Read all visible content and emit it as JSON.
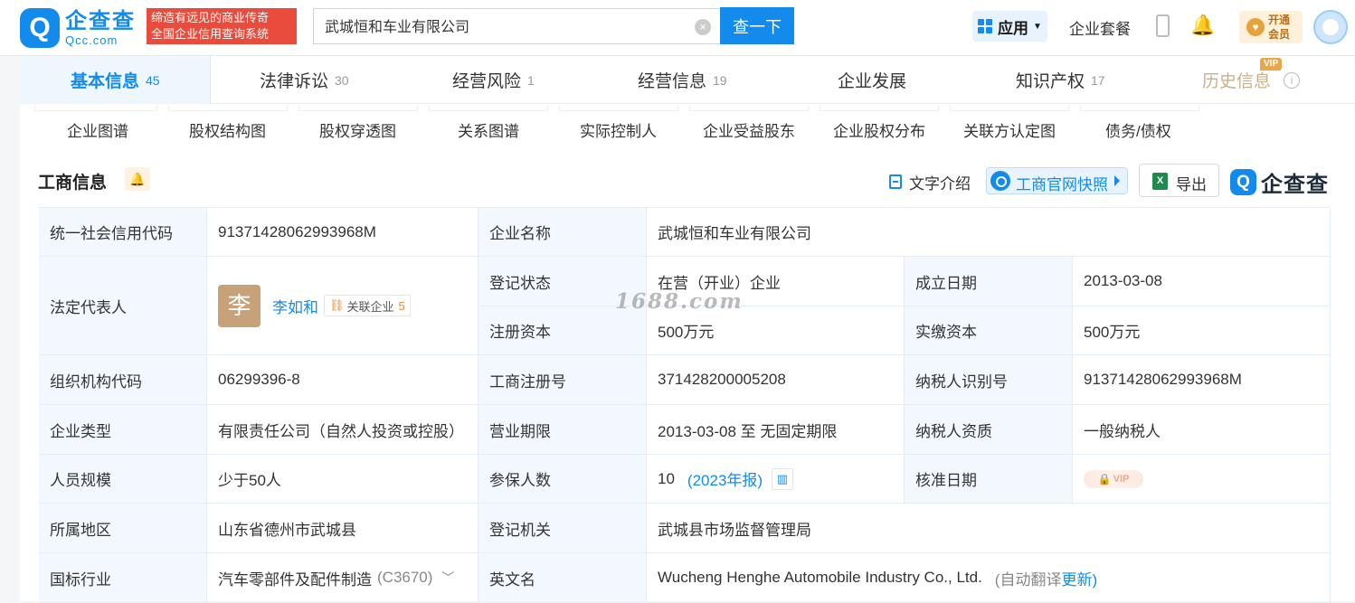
{
  "header": {
    "logo_cn": "企查查",
    "logo_en": "Qcc.com",
    "slogan_line1": "缔造有远见的商业传奇",
    "slogan_line2": "全国企业信用查询系统",
    "search_value": "武城恒和车业有限公司",
    "search_button": "查一下",
    "app_label": "应用",
    "suite_label": "企业套餐",
    "vip_line1": "开通",
    "vip_line2": "会员"
  },
  "tabs": [
    {
      "label": "基本信息",
      "count": "45",
      "active": true
    },
    {
      "label": "法律诉讼",
      "count": "30"
    },
    {
      "label": "经营风险",
      "count": "1"
    },
    {
      "label": "经营信息",
      "count": "19"
    },
    {
      "label": "企业发展",
      "count": ""
    },
    {
      "label": "知识产权",
      "count": "17"
    },
    {
      "label": "历史信息",
      "count": "",
      "vip": "VIP"
    }
  ],
  "subnav": [
    "企业图谱",
    "股权结构图",
    "股权穿透图",
    "关系图谱",
    "实际控制人",
    "企业受益股东",
    "企业股权分布",
    "关联方认定图",
    "债务/债权"
  ],
  "section": {
    "title": "工商信息",
    "text_intro": "文字介绍",
    "snapshot": "工商官网快照",
    "export": "导出",
    "brand": "企查查"
  },
  "info": {
    "credit_code_label": "统一社会信用代码",
    "credit_code": "91371428062993968M",
    "company_name_label": "企业名称",
    "company_name": "武城恒和车业有限公司",
    "legal_rep_label": "法定代表人",
    "legal_rep_avatar": "李",
    "legal_rep_name": "李如和",
    "related_label": "关联企业",
    "related_count": "5",
    "reg_status_label": "登记状态",
    "reg_status": "在营（开业）企业",
    "founded_label": "成立日期",
    "founded": "2013-03-08",
    "reg_capital_label": "注册资本",
    "reg_capital": "500万元",
    "paid_capital_label": "实缴资本",
    "paid_capital": "500万元",
    "org_code_label": "组织机构代码",
    "org_code": "06299396-8",
    "biz_reg_no_label": "工商注册号",
    "biz_reg_no": "371428200005208",
    "taxpayer_id_label": "纳税人识别号",
    "taxpayer_id": "91371428062993968M",
    "company_type_label": "企业类型",
    "company_type": "有限责任公司（自然人投资或控股）",
    "biz_term_label": "营业期限",
    "biz_term": "2013-03-08 至 无固定期限",
    "taxpayer_qual_label": "纳税人资质",
    "taxpayer_qual": "一般纳税人",
    "staff_size_label": "人员规模",
    "staff_size": "少于50人",
    "insured_label": "参保人数",
    "insured": "10",
    "insured_year": "(2023年报)",
    "approval_date_label": "核准日期",
    "approval_locked": "VIP",
    "region_label": "所属地区",
    "region": "山东省德州市武城县",
    "reg_authority_label": "登记机关",
    "reg_authority": "武城县市场监督管理局",
    "industry_label": "国标行业",
    "industry": "汽车零部件及配件制造",
    "industry_code": "(C3670)",
    "english_name_label": "英文名",
    "english_name": "Wucheng Henghe Automobile Industry Co., Ltd.",
    "auto_translate": "(自动翻译",
    "update_link": "更新)"
  },
  "watermark": "1688.com",
  "colors": {
    "primary": "#128bed",
    "label_bg": "#f2f8fe",
    "slogan_bg": "#e94b3c"
  }
}
